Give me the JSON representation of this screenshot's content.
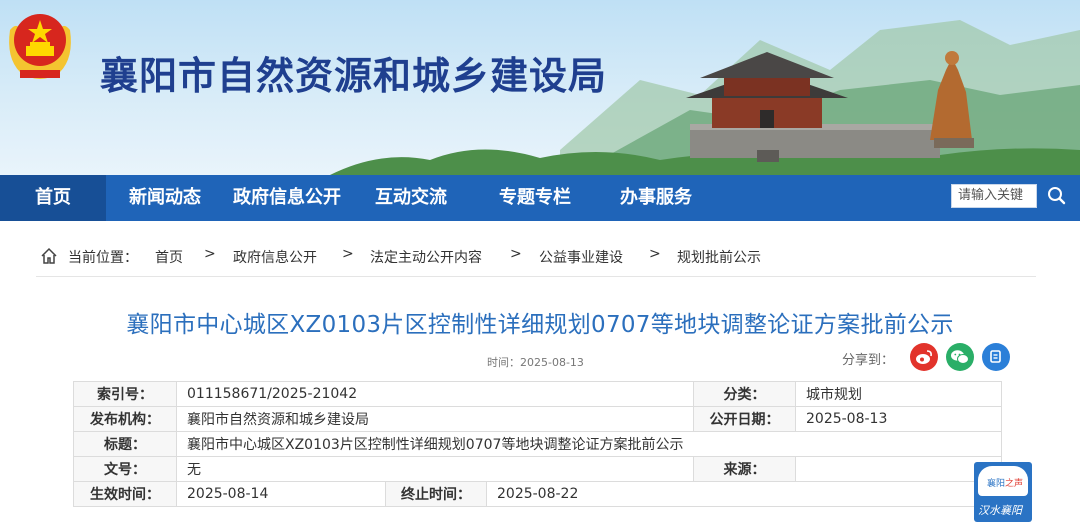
{
  "site": {
    "title": "襄阳市自然资源和城乡建设局"
  },
  "nav": {
    "items": [
      "首页",
      "新闻动态",
      "政府信息公开",
      "互动交流",
      "专题专栏",
      "办事服务"
    ],
    "search_placeholder": "请输入关键"
  },
  "breadcrumb": {
    "prefix": "当前位置：",
    "items": [
      "首页",
      "政府信息公开",
      "法定主动公开内容",
      "公益事业建设",
      "规划批前公示"
    ],
    "separator": ">"
  },
  "article": {
    "title": "襄阳市中心城区XZ0103片区控制性详细规划0707等地块调整论证方案批前公示",
    "time": "时间：2025-08-13",
    "share_label": "分享到："
  },
  "meta": {
    "index_label": "索引号：",
    "index_value": "011158671/2025-21042",
    "category_label": "分类：",
    "category_value": "城市规划",
    "publisher_label": "发布机构：",
    "publisher_value": "襄阳市自然资源和城乡建设局",
    "open_date_label": "公开日期：",
    "open_date_value": "2025-08-13",
    "title_label": "标题：",
    "title_value": "襄阳市中心城区XZ0103片区控制性详细规划0707等地块调整论证方案批前公示",
    "doc_no_label": "文号：",
    "doc_no_value": "无",
    "source_label": "来源：",
    "source_value": "",
    "effective_label": "生效时间：",
    "effective_value": "2025-08-14",
    "end_label": "终止时间：",
    "end_value": "2025-08-22"
  },
  "widget": {
    "top_prefix": "襄阳",
    "top_suffix": "之声",
    "bottom": "汉水襄阳"
  },
  "colors": {
    "nav": "#1f64b8",
    "title": "#2b6fbd",
    "site_title": "#1f3f8f",
    "weibo": "#e2332b",
    "wechat": "#2aae67",
    "qzone": "#2b7fd8"
  }
}
